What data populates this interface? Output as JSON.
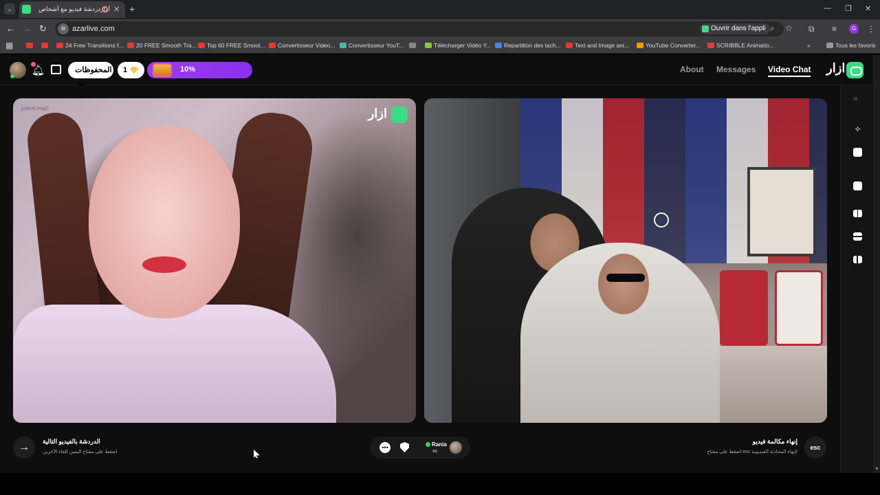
{
  "browser": {
    "tab_title": "أزاردردشة فيديو مع أشخاص",
    "url": "azarlive.com",
    "open_app_label": "Ouvrir dans l'appli",
    "profile_letter": "G",
    "bookmarks": [
      "24 Free Transitions f...",
      "20 FREE Smooth Tra...",
      "Top 60 FREE Smoot...",
      "Convertisseur Video...",
      "Convertisseur YouT...",
      "Télécharger Vidéo Y...",
      "Repartition des tach...",
      "Text and Image ani...",
      "YouTube Converter...",
      "SCRIBBLE Animatio..."
    ],
    "all_bookmarks": "Tous les favoris"
  },
  "header": {
    "saved_label": "المحفوظات",
    "gem_count": "1",
    "progress": "10%",
    "nav": [
      "About",
      "Messages",
      "Video Chat"
    ],
    "brand": "ازار"
  },
  "video_left": {
    "user_id": "px8v4LHaqC",
    "logo": "ازار"
  },
  "controls": {
    "next_title": "الدردشة بالفيديو التالية",
    "next_sub": "اضغط على مفتاح اليمين للقاء الآخرين",
    "partner_name": "Rania",
    "partner_sub": "xx",
    "end_title": "إنهاء مكالمة فيديو",
    "end_sub": "اضغط على مفتاح esc لإنهاء المحادثة الفيديوية",
    "esc_label": "esc"
  },
  "colors": {
    "accent_green": "#3ddc84",
    "progress_purple": "#9b3ff0"
  }
}
